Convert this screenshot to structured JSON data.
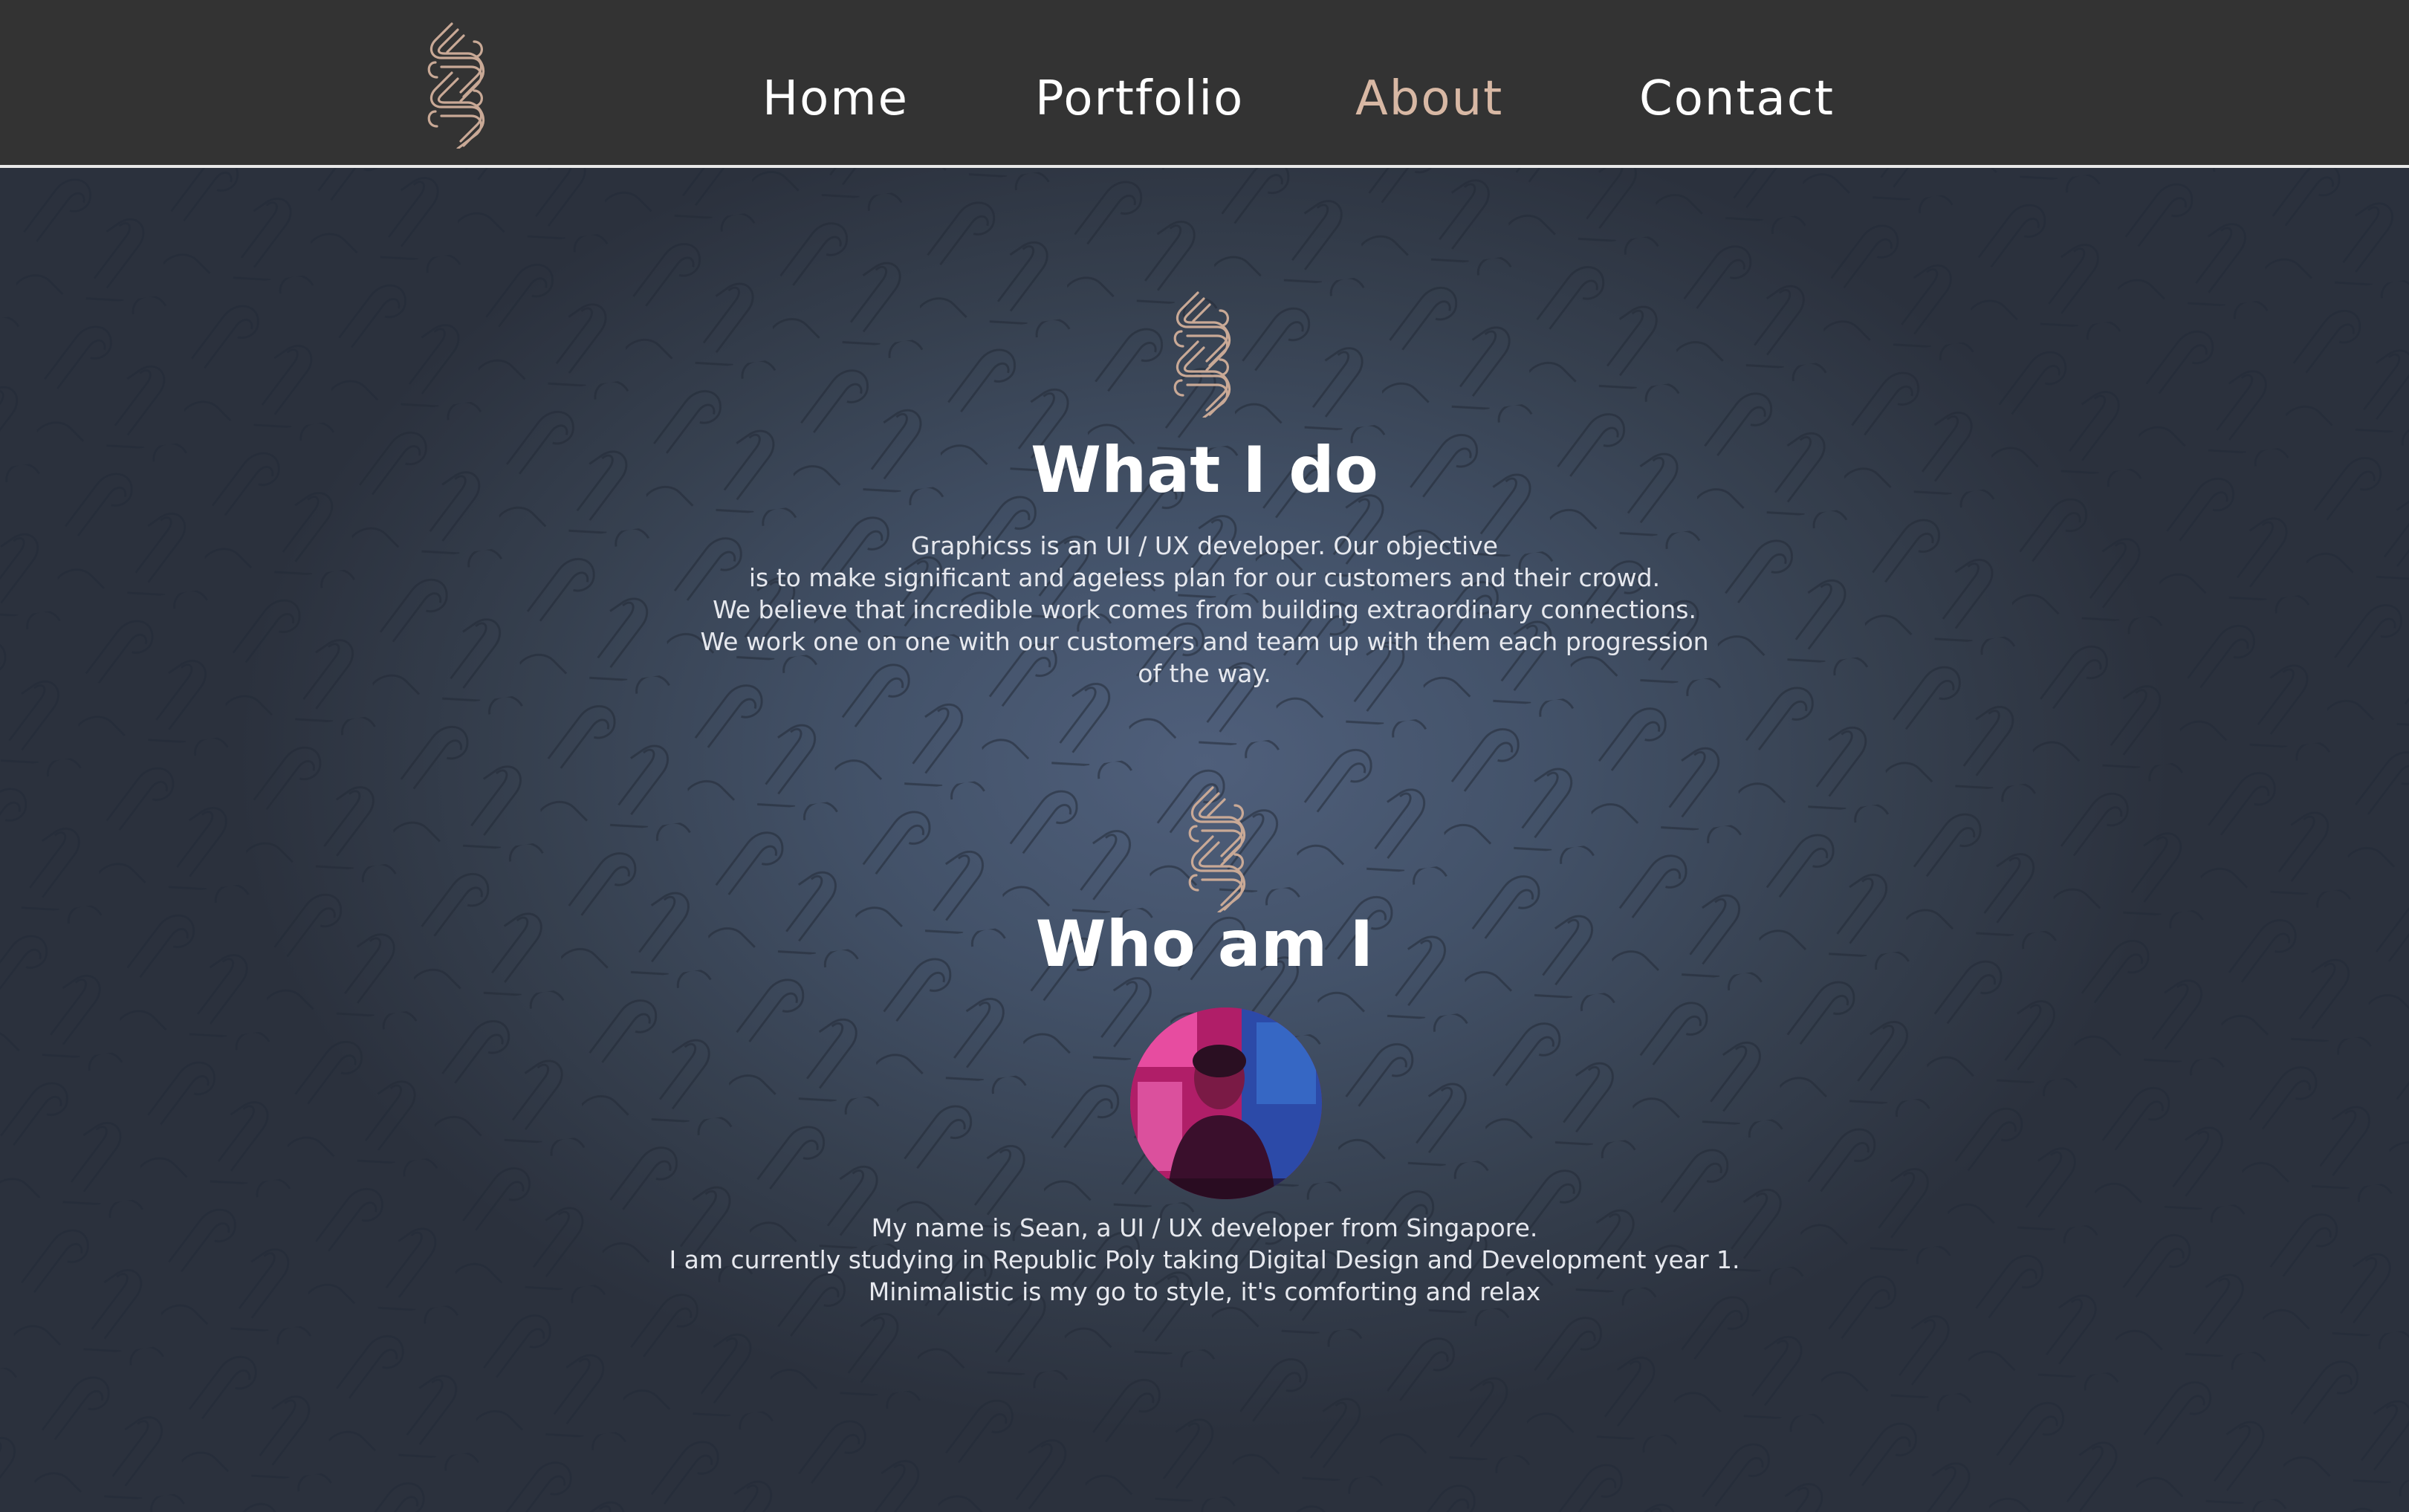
{
  "nav": {
    "logo_icon": "graphicss-chain-logo-icon",
    "items": [
      {
        "label": "Home",
        "active": false
      },
      {
        "label": "Portfolio",
        "active": false
      },
      {
        "label": "About",
        "active": true
      },
      {
        "label": "Contact",
        "active": false
      }
    ]
  },
  "sections": {
    "what_i_do": {
      "icon": "graphicss-chain-logo-icon",
      "title": "What I do",
      "lines": [
        "Graphicss is an UI / UX developer. Our objective",
        "is to make significant and ageless plan for our customers and their crowd.",
        "We believe that incredible work comes from building extraordinary connections.",
        "We work one on one with our customers and team up with them each progression",
        "of the way."
      ]
    },
    "who_am_i": {
      "icon": "graphicss-chain-logo-icon",
      "title": "Who am I",
      "avatar": "profile-photo",
      "lines": [
        "My name is Sean, a UI / UX developer from Singapore.",
        "I am currently studying in Republic Poly taking Digital Design and Development year 1.",
        "Minimalistic is my go to style, it's comforting and relax"
      ]
    }
  },
  "colors": {
    "nav_background": "#333333",
    "nav_text": "#ffffff",
    "nav_active": "#d8b8a4",
    "logo_stroke": "#c9a996",
    "background_center": "#4f5f7b",
    "background_edge": "#2b313d"
  }
}
